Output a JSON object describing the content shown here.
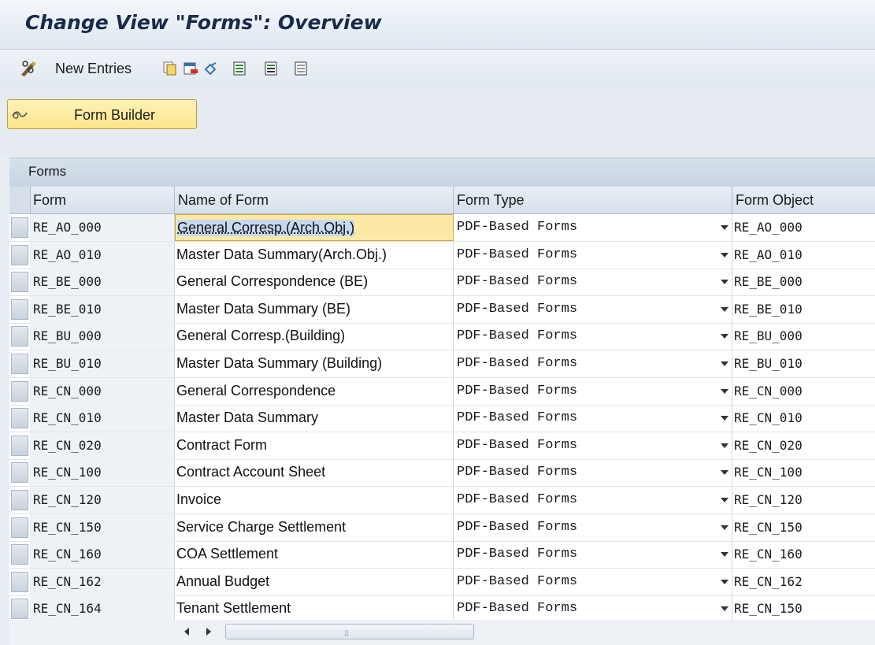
{
  "window": {
    "title": "Change View \"Forms\": Overview"
  },
  "toolbar": {
    "new_entries_label": "New Entries",
    "icons": [
      "pencil-glasses-icon",
      "copy-icon",
      "delete-icon",
      "undo-icon",
      "select-all-icon",
      "select-block-icon",
      "deselect-all-icon"
    ]
  },
  "app_toolbar": {
    "form_builder_label": "Form Builder"
  },
  "table": {
    "title": "Forms",
    "columns": [
      "Form",
      "Name of Form",
      "Form Type",
      "Form Object"
    ],
    "rows": [
      {
        "form": "RE_AO_000",
        "name": "General Corresp.(Arch.Obj.)",
        "type": "PDF-Based Forms",
        "object": "RE_AO_000"
      },
      {
        "form": "RE_AO_010",
        "name": "Master Data Summary(Arch.Obj.)",
        "type": "PDF-Based Forms",
        "object": "RE_AO_010"
      },
      {
        "form": "RE_BE_000",
        "name": "General Correspondence (BE)",
        "type": "PDF-Based Forms",
        "object": "RE_BE_000"
      },
      {
        "form": "RE_BE_010",
        "name": "Master Data Summary (BE)",
        "type": "PDF-Based Forms",
        "object": "RE_BE_010"
      },
      {
        "form": "RE_BU_000",
        "name": "General Corresp.(Building)",
        "type": "PDF-Based Forms",
        "object": "RE_BU_000"
      },
      {
        "form": "RE_BU_010",
        "name": "Master Data Summary (Building)",
        "type": "PDF-Based Forms",
        "object": "RE_BU_010"
      },
      {
        "form": "RE_CN_000",
        "name": "General Correspondence",
        "type": "PDF-Based Forms",
        "object": "RE_CN_000"
      },
      {
        "form": "RE_CN_010",
        "name": "Master Data Summary",
        "type": "PDF-Based Forms",
        "object": "RE_CN_010"
      },
      {
        "form": "RE_CN_020",
        "name": "Contract Form",
        "type": "PDF-Based Forms",
        "object": "RE_CN_020"
      },
      {
        "form": "RE_CN_100",
        "name": "Contract Account Sheet",
        "type": "PDF-Based Forms",
        "object": "RE_CN_100"
      },
      {
        "form": "RE_CN_120",
        "name": "Invoice",
        "type": "PDF-Based Forms",
        "object": "RE_CN_120"
      },
      {
        "form": "RE_CN_150",
        "name": "Service Charge Settlement",
        "type": "PDF-Based Forms",
        "object": "RE_CN_150"
      },
      {
        "form": "RE_CN_160",
        "name": "COA Settlement",
        "type": "PDF-Based Forms",
        "object": "RE_CN_160"
      },
      {
        "form": "RE_CN_162",
        "name": "Annual Budget",
        "type": "PDF-Based Forms",
        "object": "RE_CN_162"
      },
      {
        "form": "RE_CN_164",
        "name": "Tenant Settlement",
        "type": "PDF-Based Forms",
        "object": "RE_CN_150"
      }
    ]
  },
  "colors": {
    "title_text": "#1a2a4a",
    "button_yellow": "#fbe48a",
    "active_cell": "#fde9a5"
  }
}
